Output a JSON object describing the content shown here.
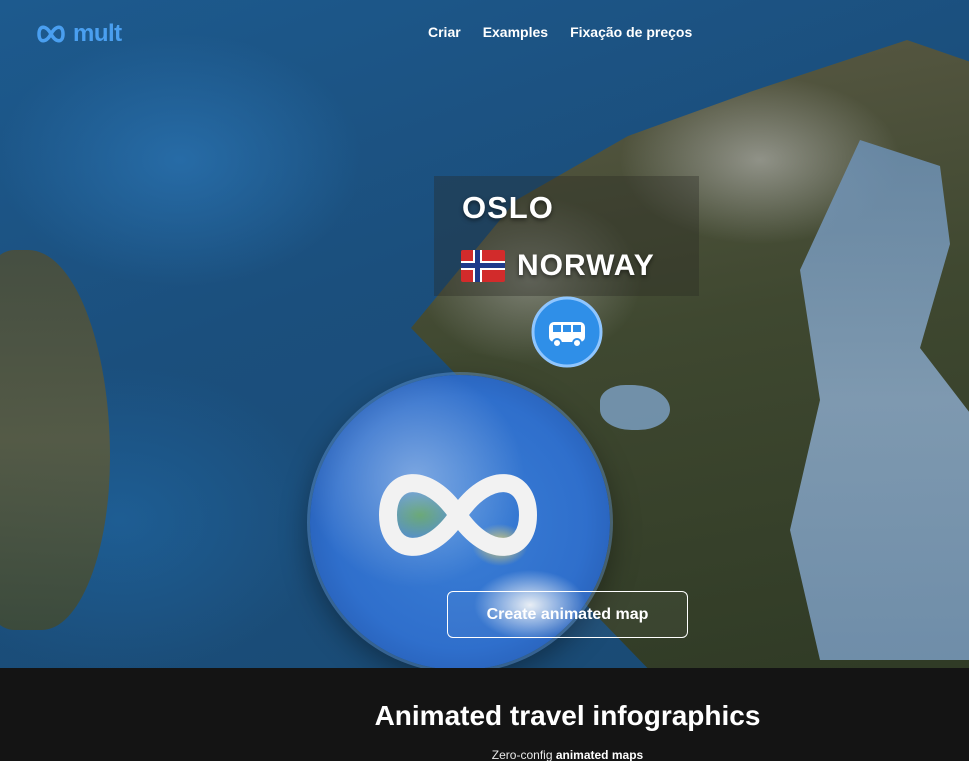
{
  "nav": {
    "logo_text": "mult",
    "links": [
      "Criar",
      "Examples",
      "Fixação de preços"
    ]
  },
  "map_labels": {
    "city": "OSLO",
    "country": "NORWAY"
  },
  "icons": {
    "logo": "mult-logo-icon",
    "flag": "norway-flag-icon",
    "pin": "van-pin-icon",
    "globe": "globe-logo-icon"
  },
  "cta": {
    "label": "Create animated map"
  },
  "footer": {
    "headline": "Animated travel infographics",
    "sub_prefix": "Zero-config ",
    "sub_bold": "animated maps"
  },
  "colors": {
    "brand": "#4a9ff0",
    "pin": "#2f8fe8",
    "footer_bg": "#141414"
  }
}
